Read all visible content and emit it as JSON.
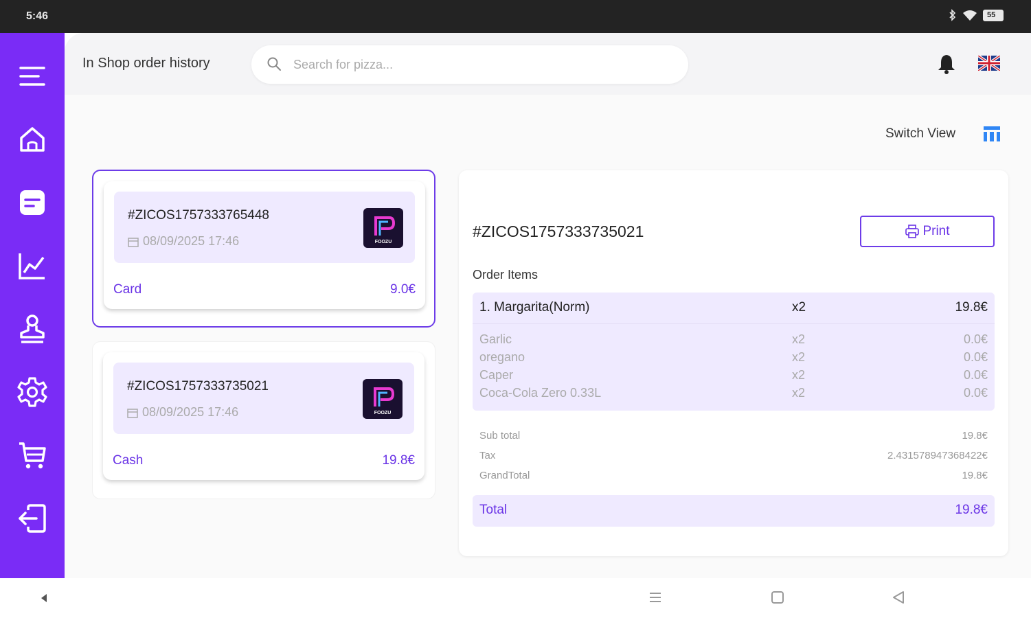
{
  "status_bar": {
    "time": "5:46",
    "battery": "55"
  },
  "header": {
    "title": "In Shop order history",
    "search_placeholder": "Search for pizza..."
  },
  "switch_view_label": "Switch View",
  "orders": [
    {
      "id": "#ZICOS1757333765448",
      "date": "08/09/2025 17:46",
      "payment": "Card",
      "amount": "9.0€",
      "logo_text": "FOOZU"
    },
    {
      "id": "#ZICOS1757333735021",
      "date": "08/09/2025 17:46",
      "payment": "Cash",
      "amount": "19.8€",
      "logo_text": "FOOZU"
    }
  ],
  "detail": {
    "id": "#ZICOS1757333735021",
    "print_label": "Print",
    "order_items_label": "Order Items",
    "main_item": {
      "name": "1. Margarita(Norm)",
      "qty": "x2",
      "price": "19.8€"
    },
    "addons": [
      {
        "name": "Garlic",
        "qty": "x2",
        "price": "0.0€"
      },
      {
        "name": "oregano",
        "qty": "x2",
        "price": "0.0€"
      },
      {
        "name": "Caper",
        "qty": "x2",
        "price": "0.0€"
      },
      {
        "name": "Coca-Cola Zero 0.33L",
        "qty": "x2",
        "price": "0.0€"
      }
    ],
    "subtotal_label": "Sub total",
    "subtotal": "19.8€",
    "tax_label": "Tax",
    "tax": "2.431578947368422€",
    "grandtotal_label": "GrandTotal",
    "grandtotal": "19.8€",
    "total_label": "Total",
    "total": "19.8€"
  },
  "colors": {
    "accent": "#7a2cf6",
    "accent_text": "#6a34e6",
    "tint": "#efeaff"
  }
}
